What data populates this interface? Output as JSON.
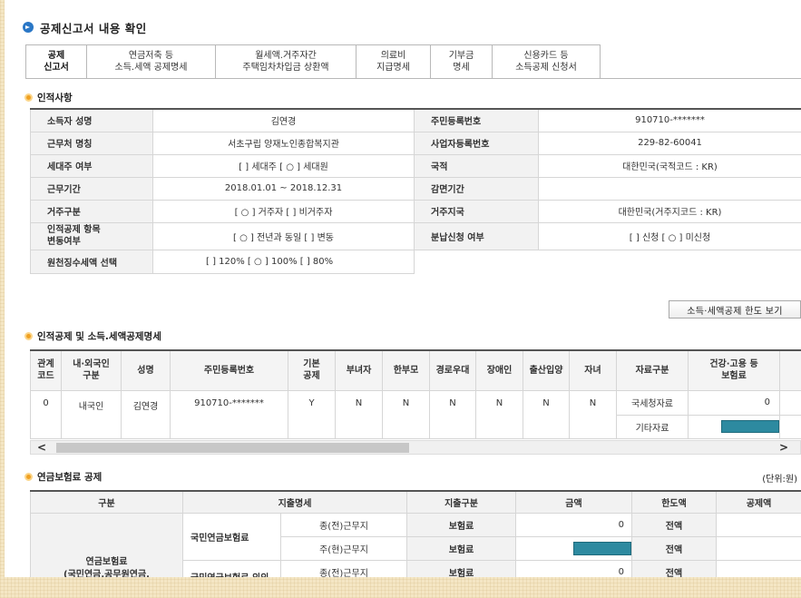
{
  "page": {
    "title": "공제신고서 내용 확인"
  },
  "tabs": [
    {
      "line1": "공제",
      "line2": "신고서"
    },
    {
      "line1": "연금저축 등",
      "line2": "소득.세액 공제명세"
    },
    {
      "line1": "월세액.거주자간",
      "line2": "주택임차차입금 상환액"
    },
    {
      "line1": "의료비",
      "line2": "지급명세"
    },
    {
      "line1": "기부금",
      "line2": "명세"
    },
    {
      "line1": "신용카드 등",
      "line2": "소득공제 신청서"
    }
  ],
  "personal": {
    "section_title": "인적사항",
    "rows": [
      {
        "l1": "소득자 성명",
        "v1": "김연경",
        "l2": "주민등록번호",
        "v2": "910710-*******"
      },
      {
        "l1": "근무처 명칭",
        "v1": "서초구립 양재노인종합복지관",
        "l2": "사업자등록번호",
        "v2": "229-82-60041"
      },
      {
        "l1": "세대주 여부",
        "v1": "[   ] 세대주  [ ○ ] 세대원",
        "l2": "국적",
        "v2": "대한민국(국적코드 : KR)"
      },
      {
        "l1": "근무기간",
        "v1": "2018.01.01 ~ 2018.12.31",
        "l2": "감면기간",
        "v2": ""
      },
      {
        "l1": "거주구분",
        "v1": "[ ○ ] 거주자  [   ] 비거주자",
        "l2": "거주지국",
        "v2": "대한민국(거주지코드 : KR)"
      },
      {
        "l1a": "인적공제 항목",
        "l1b": "변동여부",
        "v1": "[ ○ ] 전년과 동일  [   ] 변동",
        "l2": "분납신청 여부",
        "v2": "[     ] 신청  [ ○ ] 미신청"
      },
      {
        "l1": "원천징수세액 선택",
        "v1": "[     ] 120%  [ ○ ] 100%  [     ] 80%"
      }
    ]
  },
  "limit_button": "소득·세액공제 한도 보기",
  "deduction": {
    "section_title": "인적공제 및 소득.세액공제명세",
    "headers": [
      {
        "a": "관계",
        "b": "코드"
      },
      {
        "a": "내·외국인",
        "b": "구분"
      },
      {
        "a": "성명",
        "b": ""
      },
      {
        "a": "주민등록번호",
        "b": ""
      },
      {
        "a": "기본",
        "b": "공제"
      },
      {
        "a": "부녀자",
        "b": ""
      },
      {
        "a": "한부모",
        "b": ""
      },
      {
        "a": "경로우대",
        "b": ""
      },
      {
        "a": "장애인",
        "b": ""
      },
      {
        "a": "출산입양",
        "b": ""
      },
      {
        "a": "자녀",
        "b": ""
      },
      {
        "a": "자료구분",
        "b": ""
      },
      {
        "a": "건강·고용 등",
        "b": "보험료"
      }
    ],
    "row": {
      "code": "0",
      "nationality": "내국인",
      "name": "김연경",
      "rrn": "910710-*******",
      "basic": "Y",
      "woman": "N",
      "single_parent": "N",
      "elderly": "N",
      "disabled": "N",
      "birth": "N",
      "child": "N",
      "source1": "국세청자료",
      "value1": "0",
      "source2": "기타자료"
    },
    "bar_color": "#2d8aa0"
  },
  "pension": {
    "section_title": "연금보험료 공제",
    "unit": "(단위:원)",
    "headers": [
      "구분",
      "지출명세",
      "지출구분",
      "금액",
      "한도액",
      "공제액"
    ],
    "category_line1": "연금보험료",
    "category_line2": "(국민연금,공무원연금,",
    "group1": "국민연금보험료",
    "group2": "국민연금보험료 외의",
    "rows": [
      {
        "detail": "종(전)근무지",
        "kind": "보험료",
        "amount": "0",
        "limit": "전액"
      },
      {
        "detail": "주(현)근무지",
        "kind": "보험료",
        "amount": "",
        "limit": "전액"
      },
      {
        "detail": "종(전)근무지",
        "kind": "보험료",
        "amount": "0",
        "limit": "전액"
      }
    ]
  },
  "scroll": {
    "left_arrow": "<",
    "right_arrow": ">"
  }
}
